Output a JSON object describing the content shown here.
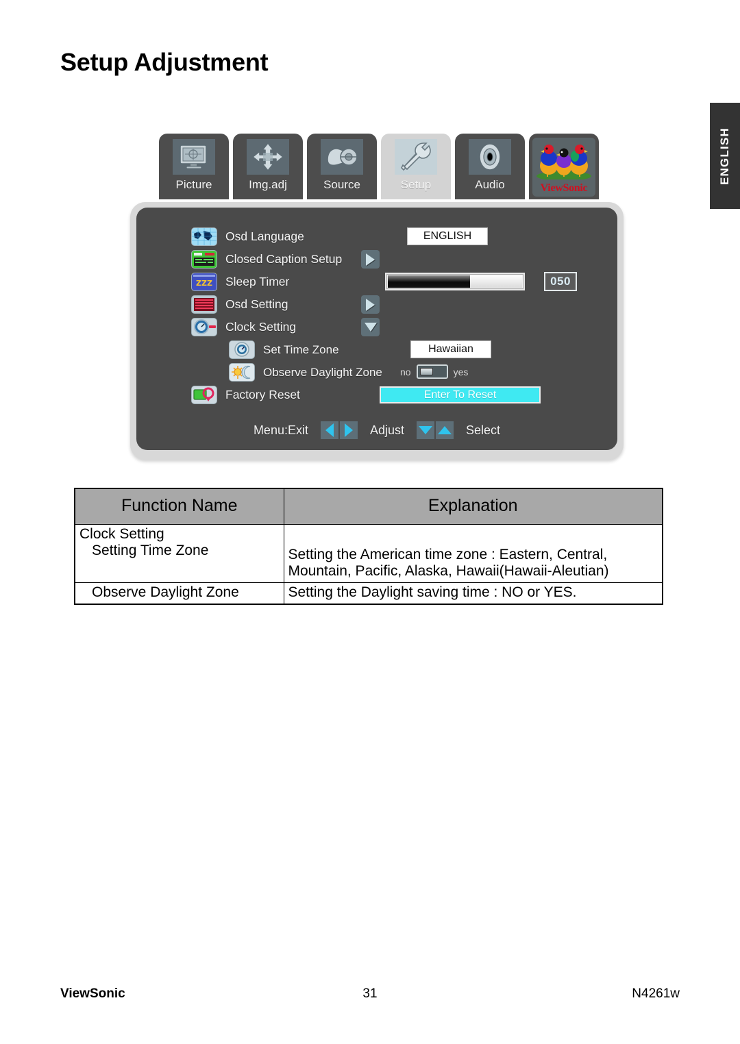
{
  "page": {
    "title": "Setup Adjustment",
    "language_tab": "ENGLISH"
  },
  "osd": {
    "tabs": [
      {
        "label": "Picture",
        "icon": "monitor-icon",
        "active": false
      },
      {
        "label": "Img.adj",
        "icon": "four-arrows-icon",
        "active": false
      },
      {
        "label": "Source",
        "icon": "plug-input-icon",
        "active": false
      },
      {
        "label": "Setup",
        "icon": "tools-icon",
        "active": true
      },
      {
        "label": "Audio",
        "icon": "speaker-icon",
        "active": false
      },
      {
        "label": "ViewSonic",
        "icon": "viewsonic-birds-logo",
        "active": false
      }
    ],
    "menu": [
      {
        "label": "Osd Language",
        "icon": "world-map-icon",
        "control": "value",
        "value": "ENGLISH"
      },
      {
        "label": "Closed Caption Setup",
        "icon": "caption-icon",
        "control": "arrow-right"
      },
      {
        "label": "Sleep Timer",
        "icon": "zzz-icon",
        "control": "slider",
        "value": "050",
        "percent": 62
      },
      {
        "label": "Osd Setting",
        "icon": "osd-stripes-icon",
        "control": "arrow-right"
      },
      {
        "label": "Clock Setting",
        "icon": "clock-dial-icon",
        "control": "arrow-down"
      },
      {
        "label": "Set Time Zone",
        "icon": "clock-small-icon",
        "control": "value",
        "value": "Hawaiian",
        "sub": true
      },
      {
        "label": "Observe Daylight Zone",
        "icon": "sun-moon-icon",
        "control": "toggle",
        "off_label": "no",
        "on_label": "yes",
        "state": "no",
        "sub": true
      },
      {
        "label": "Factory Reset",
        "icon": "factory-reset-icon",
        "control": "button",
        "value": "Enter To Reset"
      }
    ],
    "footer": {
      "exit_label": "Menu:Exit",
      "adjust_label": "Adjust",
      "select_label": "Select"
    },
    "colors": {
      "panel": "#4a4a4a",
      "frame": "#d8d8d8",
      "accent_cyan": "#3fe9f2",
      "key_blue": "#2fc4ee",
      "active_tab": "#d3d3d3"
    }
  },
  "table": {
    "headers": [
      "Function Name",
      "Explanation"
    ],
    "rows": [
      {
        "function_main": "Clock Setting",
        "function_sub": "Setting Time Zone",
        "explanation_lines": [
          "Setting the American time zone : Eastern, Central,",
          "Mountain, Pacific, Alaska, Hawaii(Hawaii-Aleutian)"
        ]
      },
      {
        "function_main": "",
        "function_sub": "Observe Daylight Zone",
        "explanation_lines": [
          "Setting the Daylight saving time : NO or YES."
        ]
      }
    ]
  },
  "footer": {
    "brand": "ViewSonic",
    "page_number": "31",
    "model": "N4261w"
  }
}
